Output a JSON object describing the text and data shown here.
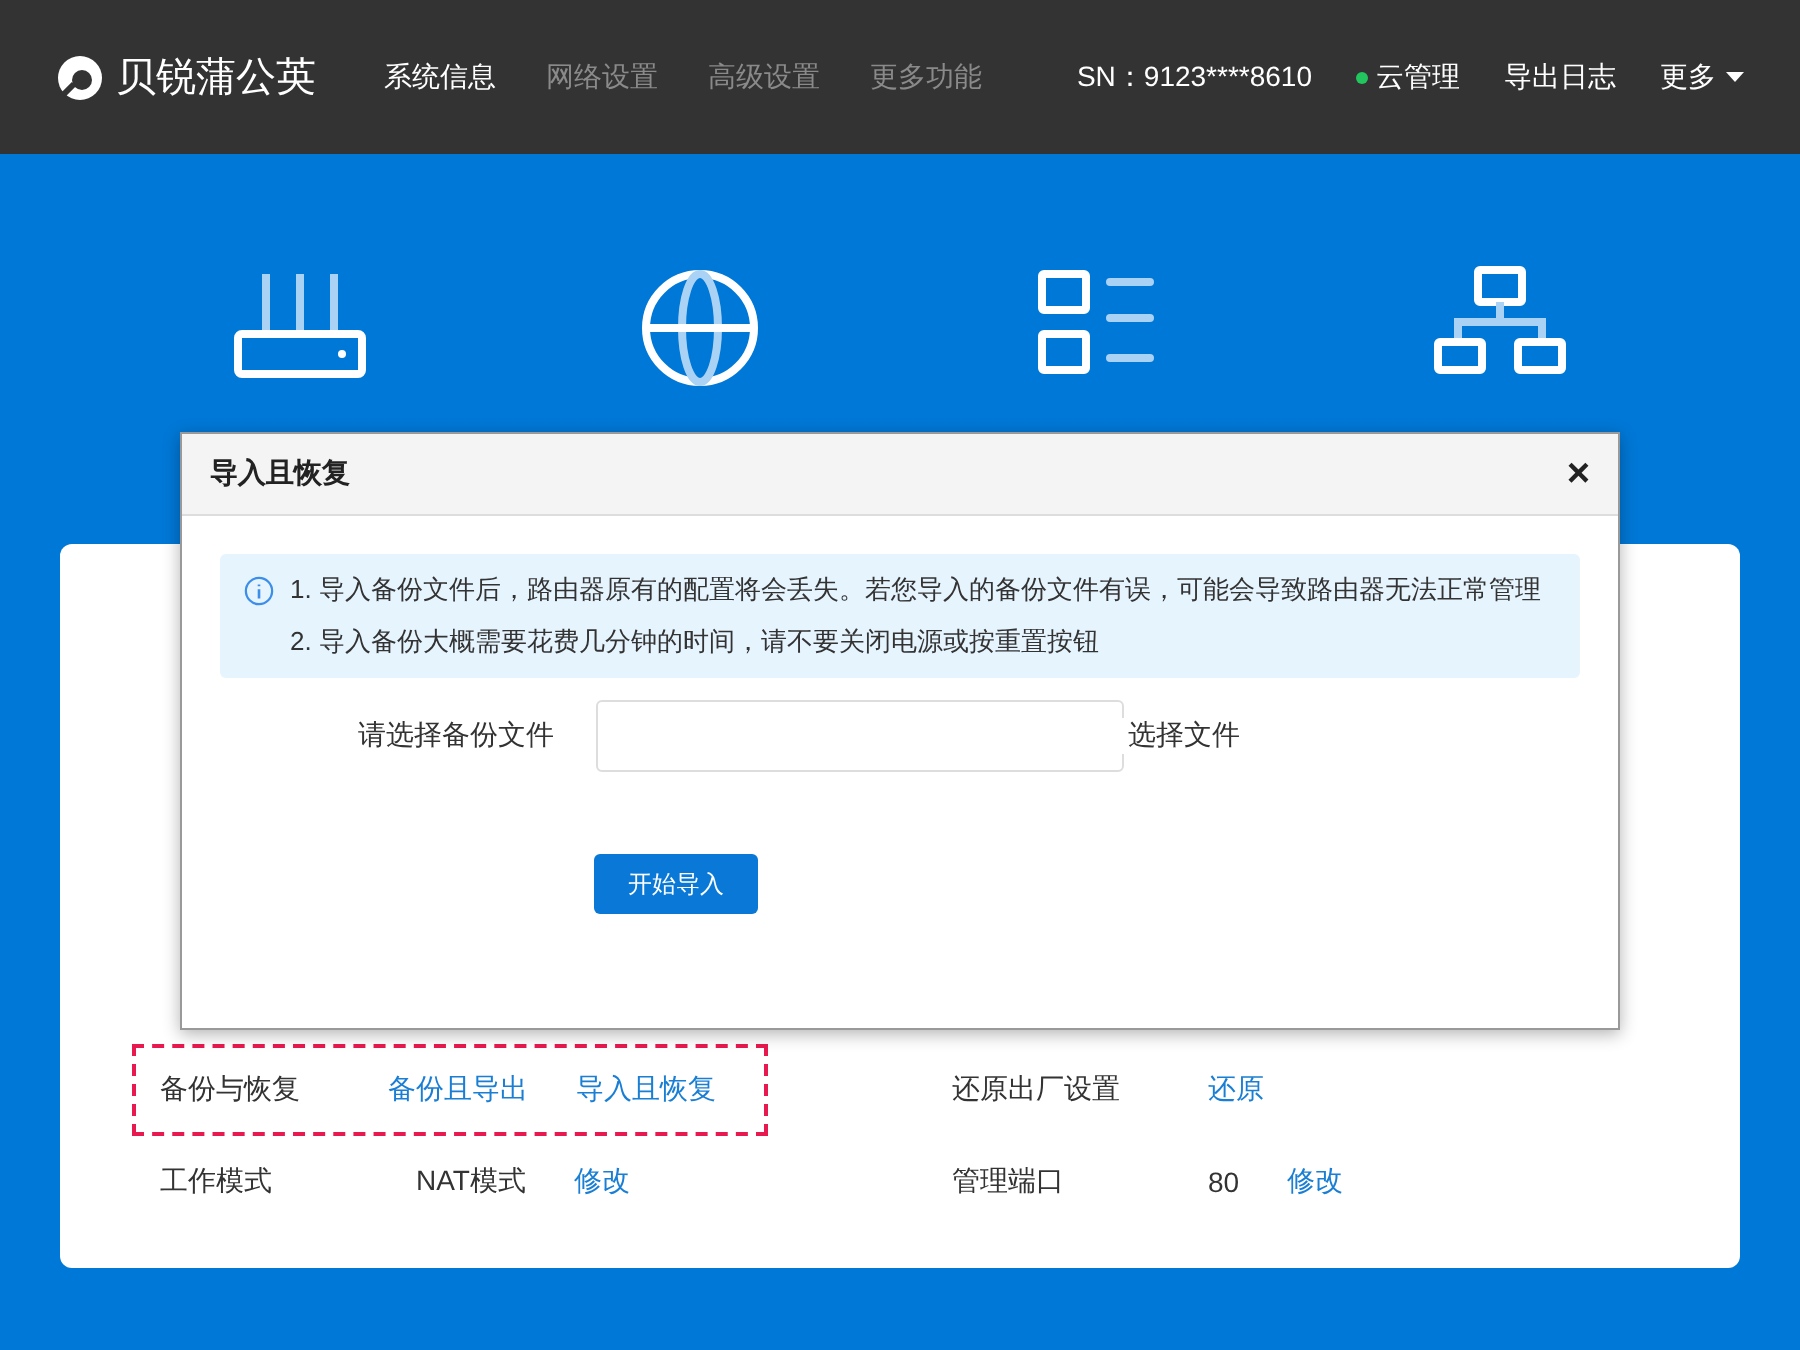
{
  "header": {
    "logo": "贝锐蒲公英",
    "nav": [
      {
        "label": "系统信息",
        "selected": true
      },
      {
        "label": "网络设置",
        "selected": false
      },
      {
        "label": "高级设置",
        "selected": false
      },
      {
        "label": "更多功能",
        "selected": false
      }
    ],
    "sn": "SN：9123****8610",
    "cloud": {
      "label": "云管理",
      "color": "#22c55e"
    },
    "export_log": "导出日志",
    "more": "更多"
  },
  "tiles": [
    {
      "kind": "router"
    },
    {
      "kind": "globe"
    },
    {
      "kind": "list"
    },
    {
      "kind": "network"
    }
  ],
  "settings": [
    {
      "label": "备份与恢复",
      "highlighted": true,
      "links": [
        "备份且导出",
        "导入且恢复"
      ]
    },
    {
      "label": "还原出厂设置",
      "highlighted": false,
      "links": [
        "还原"
      ]
    },
    {
      "label": "工作模式",
      "highlighted": false,
      "value": "NAT模式",
      "links": [
        "修改"
      ]
    },
    {
      "label": "管理端口",
      "highlighted": false,
      "value": "80",
      "links": [
        "修改"
      ]
    }
  ],
  "dialog": {
    "title": "导入且恢复",
    "close": "×",
    "notices": [
      "1. 导入备份文件后，路由器原有的配置将会丢失。若您导入的备份文件有误，可能会导致路由器无法正常管理",
      "2. 导入备份大概需要花费几分钟的时间，请不要关闭电源或按重置按钮"
    ],
    "file_label": "请选择备份文件",
    "file_button": "选择文件",
    "submit": "开始导入"
  }
}
